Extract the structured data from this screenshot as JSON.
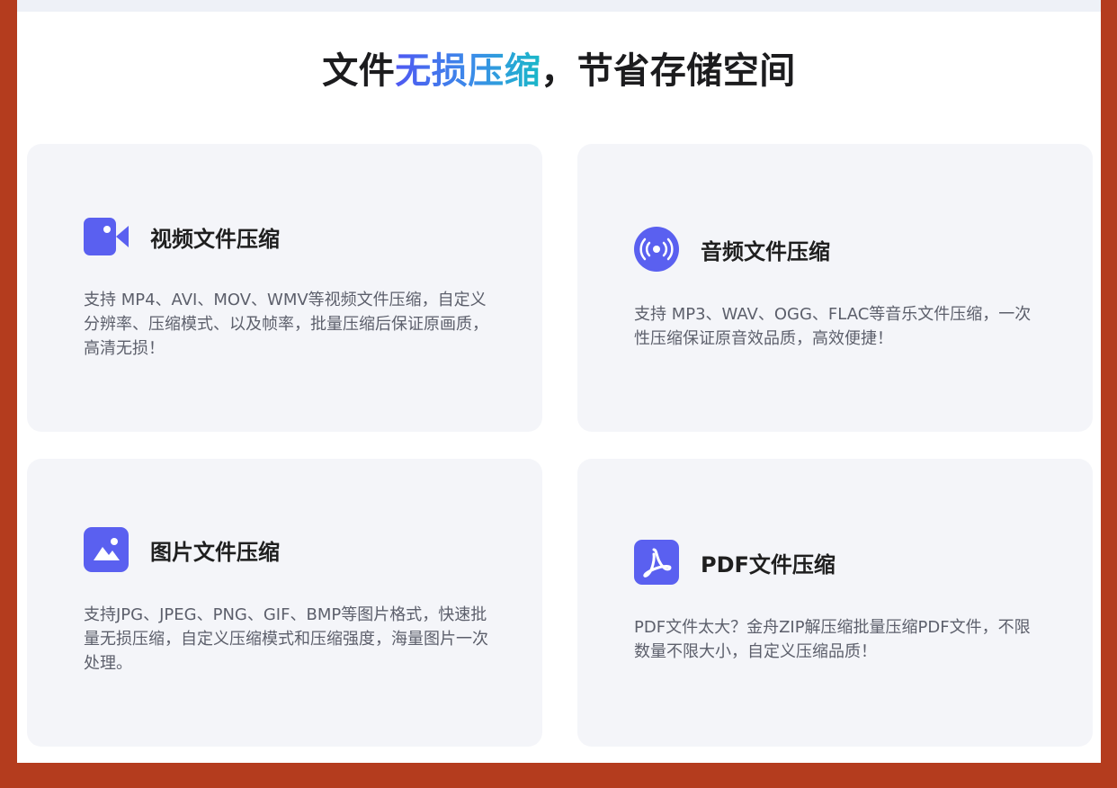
{
  "headline": {
    "prefix": "文件",
    "highlight": "无损压缩",
    "suffix": "，节省存储空间"
  },
  "colors": {
    "background_border": "#b43c1e",
    "card_bg": "#f4f5f9",
    "accent_start": "#4f58f2",
    "accent_end": "#1ab8c8",
    "icon_blue": "#5a60f0"
  },
  "cards": [
    {
      "icon": "video-camera-icon",
      "title": "视频文件压缩",
      "description": "支持 MP4、AVI、MOV、WMV等视频文件压缩，自定义分辨率、压缩模式、以及帧率，批量压缩后保证原画质，高清无损！"
    },
    {
      "icon": "audio-wave-icon",
      "title": "音频文件压缩",
      "description": "支持 MP3、WAV、OGG、FLAC等音乐文件压缩，一次性压缩保证原音效品质，高效便捷！"
    },
    {
      "icon": "image-icon",
      "title": "图片文件压缩",
      "description": "支持JPG、JPEG、PNG、GIF、BMP等图片格式，快速批量无损压缩，自定义压缩模式和压缩强度，海量图片一次处理。"
    },
    {
      "icon": "pdf-icon",
      "title": "PDF文件压缩",
      "description": "PDF文件太大？金舟ZIP解压缩批量压缩PDF文件，不限数量不限大小，自定义压缩品质！"
    }
  ]
}
